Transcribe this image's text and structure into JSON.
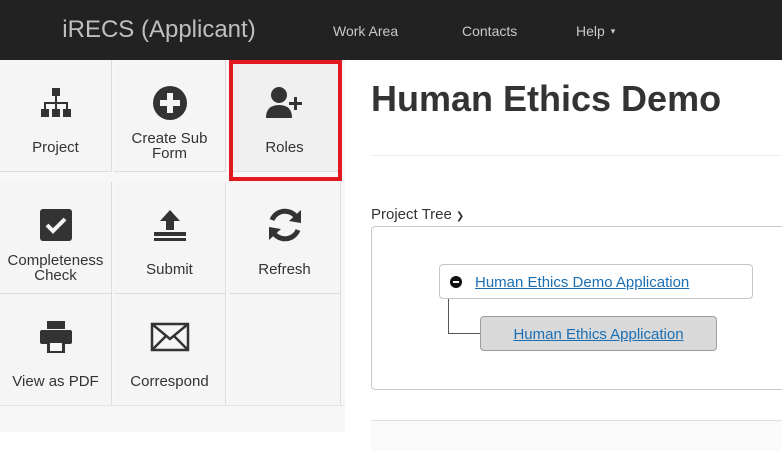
{
  "navbar": {
    "brand": "iRECS (Applicant)",
    "links": [
      "Work Area",
      "Contacts",
      "Help"
    ],
    "help_caret": "▾"
  },
  "toolbar": {
    "items": [
      {
        "label": "Project",
        "icon": "project-tree-icon"
      },
      {
        "label": "Create Sub Form",
        "icon": "plus-circle-icon"
      },
      {
        "label": "Roles",
        "icon": "add-user-icon",
        "highlighted": true
      },
      {
        "label": "Completeness Check",
        "icon": "checkbox-icon"
      },
      {
        "label": "Submit",
        "icon": "upload-icon"
      },
      {
        "label": "Refresh",
        "icon": "refresh-icon"
      },
      {
        "label": "View as PDF",
        "icon": "printer-icon"
      },
      {
        "label": "Correspond",
        "icon": "envelope-icon"
      }
    ]
  },
  "main": {
    "title": "Human Ethics Demo",
    "tree_heading": "Project Tree",
    "tree": {
      "root": "Human Ethics Demo Application",
      "child": "Human Ethics Application"
    }
  },
  "colors": {
    "navbar_bg": "#222222",
    "highlight_border": "#e2191f",
    "link": "#1a6fb4",
    "child_node_bg": "#d9d9d9"
  }
}
